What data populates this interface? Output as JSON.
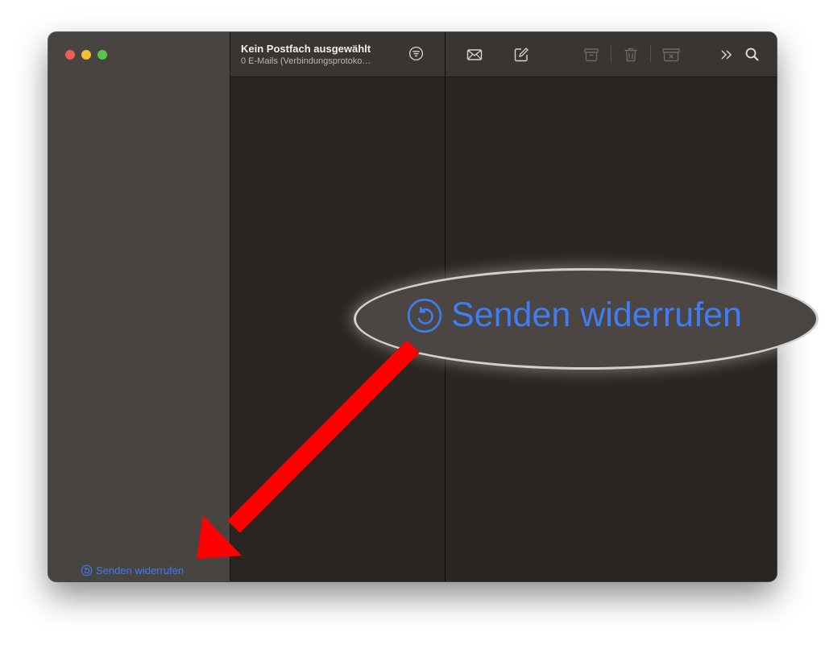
{
  "window": {
    "traffic_lights": {
      "close": "#ee5d55",
      "minimize": "#f5bd33",
      "maximize": "#5ac645"
    }
  },
  "sidebar": {
    "undo_send_label": "Senden widerrufen",
    "undo_send_icon": "undo-send-icon"
  },
  "message_list": {
    "title": "Kein Postfach ausgewählt",
    "subtitle": "0 E-Mails (Verbindungsprotoko…",
    "filter_icon": "filter-icon"
  },
  "toolbar": {
    "icons": [
      "envelope-icon",
      "compose-icon",
      "archive-icon",
      "trash-icon",
      "junk-icon",
      "more-icon",
      "search-icon"
    ]
  },
  "callout": {
    "label": "Senden widerrufen",
    "icon": "undo-send-icon"
  },
  "colors": {
    "accent_blue": "#3d7cf0",
    "arrow_red": "#ff0000",
    "sidebar_bg": "#484442",
    "content_bg": "#2a2422"
  }
}
